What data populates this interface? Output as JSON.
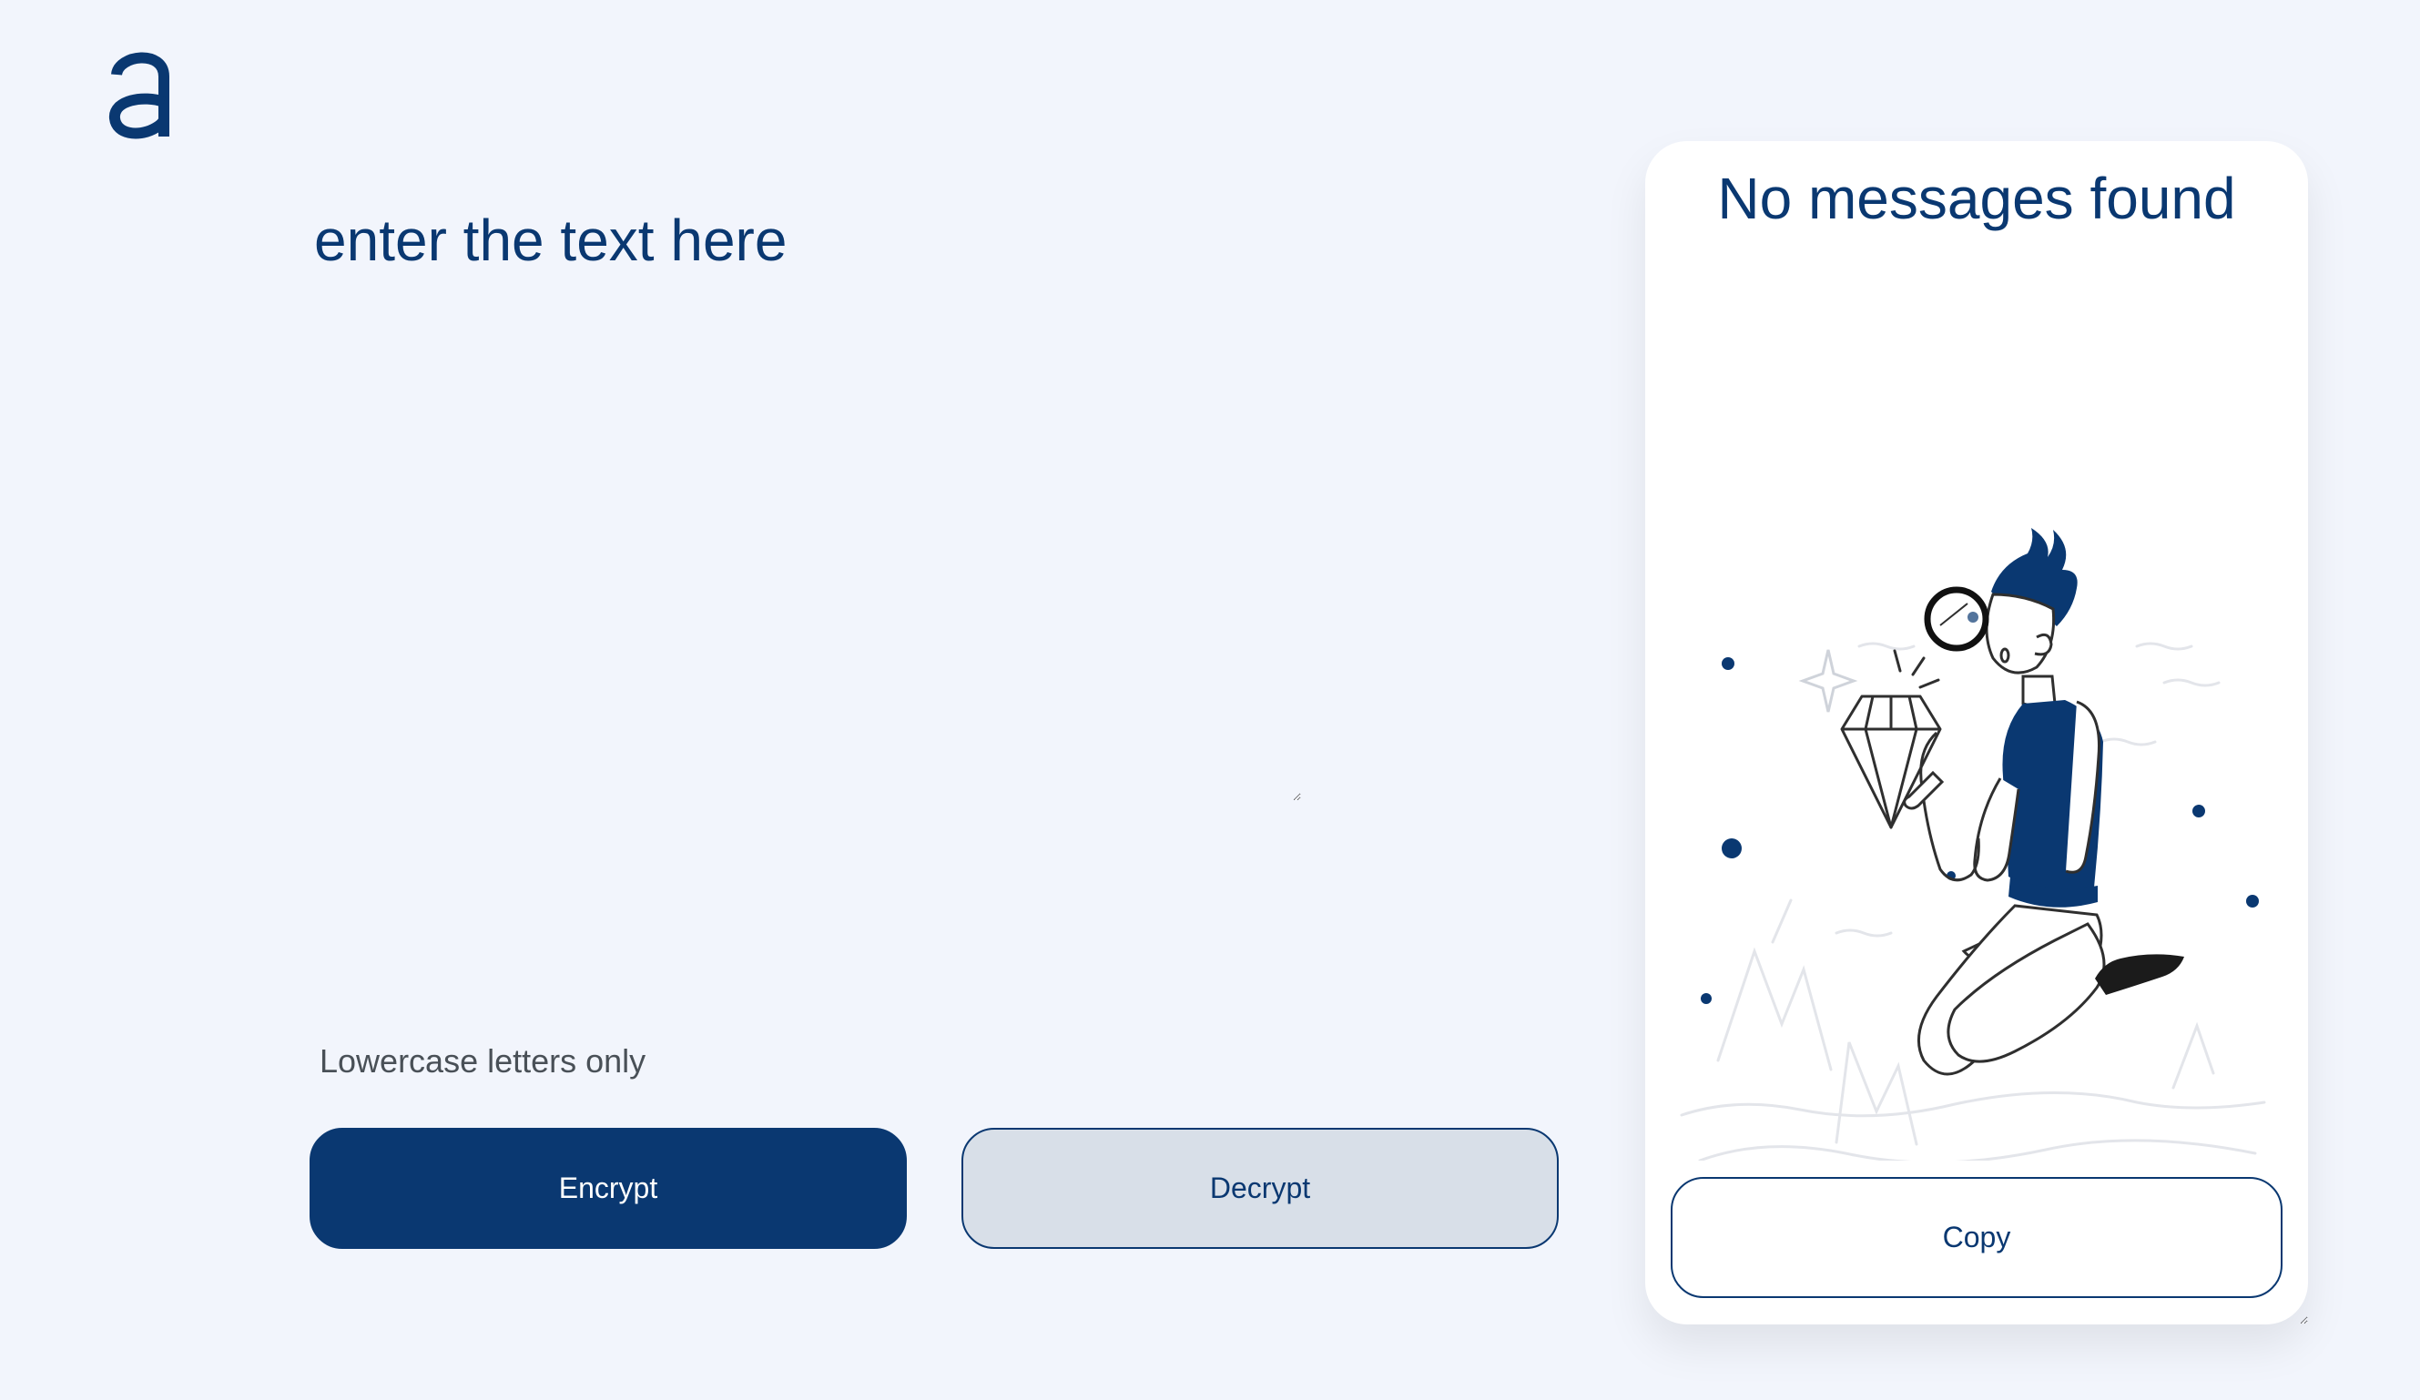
{
  "logo": {
    "icon": "alura-logo-icon",
    "color": "#0a3871"
  },
  "editor": {
    "placeholder": "enter the text here",
    "value": ""
  },
  "hint": {
    "icon": "info-icon",
    "text": "Lowercase letters only"
  },
  "actions": {
    "encrypt_label": "Encrypt",
    "decrypt_label": "Decrypt"
  },
  "output": {
    "title": "No messages found",
    "illustration": "person-with-magnifier-looking-at-diamond-illustration",
    "copy_label": "Copy"
  },
  "colors": {
    "background": "#f2f5fc",
    "primary": "#0a3871",
    "secondary_button": "#d8dfe8",
    "panel": "#ffffff",
    "hint_text": "#495057"
  }
}
